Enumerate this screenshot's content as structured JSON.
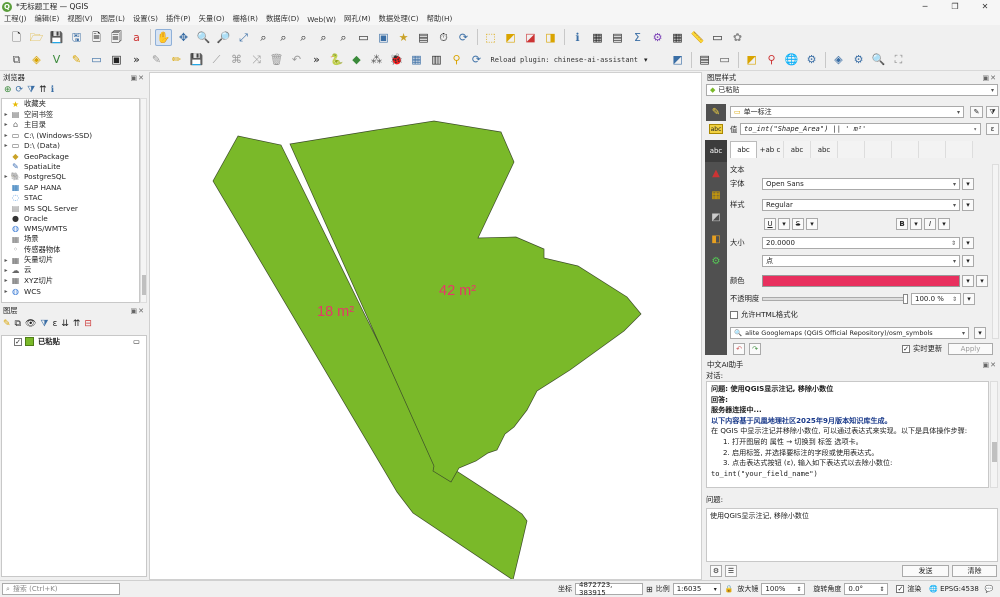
{
  "window": {
    "title": "*无标题工程 — QGIS",
    "logo_text": "Q"
  },
  "menu": [
    "工程(J)",
    "编辑(E)",
    "视图(V)",
    "图层(L)",
    "设置(S)",
    "插件(P)",
    "矢量(O)",
    "栅格(R)",
    "数据库(D)",
    "Web(W)",
    "网孔(M)",
    "数据处理(C)",
    "帮助(H)"
  ],
  "toolbar": {
    "reload_plugin": "Reload plugin: chinese-ai-assistant"
  },
  "browser": {
    "title": "浏览器",
    "items": [
      {
        "label": "收藏夹",
        "icon": "star-icon",
        "glyph": "★",
        "color": "#e6b800",
        "arrow": ""
      },
      {
        "label": "空间书签",
        "icon": "bookmark-icon",
        "glyph": "▤",
        "color": "#666",
        "arrow": "▸"
      },
      {
        "label": "主目录",
        "icon": "home-icon",
        "glyph": "⌂",
        "color": "#666",
        "arrow": "▸"
      },
      {
        "label": "C:\\ (Windows-SSD)",
        "icon": "drive-icon",
        "glyph": "▭",
        "color": "#555",
        "arrow": "▸"
      },
      {
        "label": "D:\\ (Data)",
        "icon": "drive-icon",
        "glyph": "▭",
        "color": "#555",
        "arrow": "▸"
      },
      {
        "label": "GeoPackage",
        "icon": "geopackage-icon",
        "glyph": "◆",
        "color": "#c9a227",
        "arrow": ""
      },
      {
        "label": "SpatiaLite",
        "icon": "spatialite-icon",
        "glyph": "✎",
        "color": "#3b6db3",
        "arrow": ""
      },
      {
        "label": "PostgreSQL",
        "icon": "postgresql-icon",
        "glyph": "🐘",
        "color": "#336791",
        "arrow": "▸"
      },
      {
        "label": "SAP HANA",
        "icon": "sap-hana-icon",
        "glyph": "▦",
        "color": "#1f6fb5",
        "arrow": ""
      },
      {
        "label": "STAC",
        "icon": "stac-icon",
        "glyph": "◌",
        "color": "#4a90d9",
        "arrow": ""
      },
      {
        "label": "MS SQL Server",
        "icon": "mssql-icon",
        "glyph": "▤",
        "color": "#888",
        "arrow": ""
      },
      {
        "label": "Oracle",
        "icon": "oracle-icon",
        "glyph": "●",
        "color": "#333",
        "arrow": ""
      },
      {
        "label": "WMS/WMTS",
        "icon": "wms-icon",
        "glyph": "◍",
        "color": "#3a7bd5",
        "arrow": ""
      },
      {
        "label": "场景",
        "icon": "scene-icon",
        "glyph": "▦",
        "color": "#777",
        "arrow": ""
      },
      {
        "label": "传感器物体",
        "icon": "sensor-icon",
        "glyph": "◦",
        "color": "#777",
        "arrow": ""
      },
      {
        "label": "矢量切片",
        "icon": "vector-tiles-icon",
        "glyph": "▦",
        "color": "#666",
        "arrow": "▸"
      },
      {
        "label": "云",
        "icon": "cloud-icon",
        "glyph": "☁",
        "color": "#666",
        "arrow": "▸"
      },
      {
        "label": "XYZ切片",
        "icon": "xyz-tiles-icon",
        "glyph": "▦",
        "color": "#666",
        "arrow": "▸"
      },
      {
        "label": "WCS",
        "icon": "wcs-icon",
        "glyph": "◍",
        "color": "#3a7bd5",
        "arrow": "▸"
      }
    ]
  },
  "layers": {
    "title": "图层",
    "items": [
      {
        "name": "已粘贴",
        "checked": "✓",
        "fill": "#7ab929"
      }
    ]
  },
  "map": {
    "fill": "#7ab929",
    "label_color": "#e8366a",
    "labels": [
      {
        "text": "18 m²"
      },
      {
        "text": "42 m²"
      }
    ]
  },
  "styling": {
    "title": "图层样式",
    "layer": "已粘贴",
    "mode": "单一标注",
    "value_label": "值",
    "expression": "to_int(\"Shape_Area\") || ' m²'",
    "section": "文本",
    "font_label": "字体",
    "font": "Open Sans",
    "style_label": "样式",
    "style": "Regular",
    "size_label": "大小",
    "size": "20.0000",
    "unit": "点",
    "color_label": "颜色",
    "color": "#e8305e",
    "opacity_label": "不透明度",
    "opacity": "100.0 %",
    "html_label": "允许HTML格式化",
    "preset": "alite Googlemaps (QGIS Official Repository)/osm_symbols",
    "live_update": "实时更新",
    "apply": "Apply",
    "tabs": [
      "abc",
      "+ab c",
      "abc",
      "abc",
      "",
      "",
      "",
      "",
      ""
    ]
  },
  "ai": {
    "title": "中文AI助手",
    "dialog_label": "对话:",
    "lines": [
      {
        "text": "问题: 使用QGIS显示注记, 移除小数位",
        "bold": true
      },
      {
        "text": "回答:",
        "bold": true
      },
      {
        "text": "服务器连接中...",
        "bold": true
      },
      {
        "text": "以下内容基于风凰地理社区2025年9月版本知识库生成。",
        "bold": true
      },
      {
        "text": "在 QGIS 中显示注记并移除小数位, 可以通过表达式来实现。以下是具体操作步骤:",
        "bold": false
      },
      {
        "text": "1. 打开图层的 属性 → 切换到 标签 选项卡。",
        "bold": false
      },
      {
        "text": "2. 启用标签, 并选择要标注的字段或使用表达式。",
        "bold": false
      },
      {
        "text": "3. 点击表达式按钮 (ε), 输入如下表达式以去除小数位:",
        "bold": false
      },
      {
        "text": "to_int(\"your_field_name\")",
        "bold": false
      }
    ],
    "question_label": "问题:",
    "question": "使用QGIS显示注记, 移除小数位",
    "send": "发送",
    "clear": "清除"
  },
  "status": {
    "search_placeholder": "搜索 (Ctrl+K)",
    "coord_label": "坐标",
    "coord": "4872723, 383915",
    "scale_label": "比例",
    "scale": "1:6035",
    "magnifier_label": "放大镜",
    "magnifier": "100%",
    "rotation_label": "旋转角度",
    "rotation": "0.0°",
    "render_label": "渲染",
    "crs": "EPSG:4538"
  }
}
